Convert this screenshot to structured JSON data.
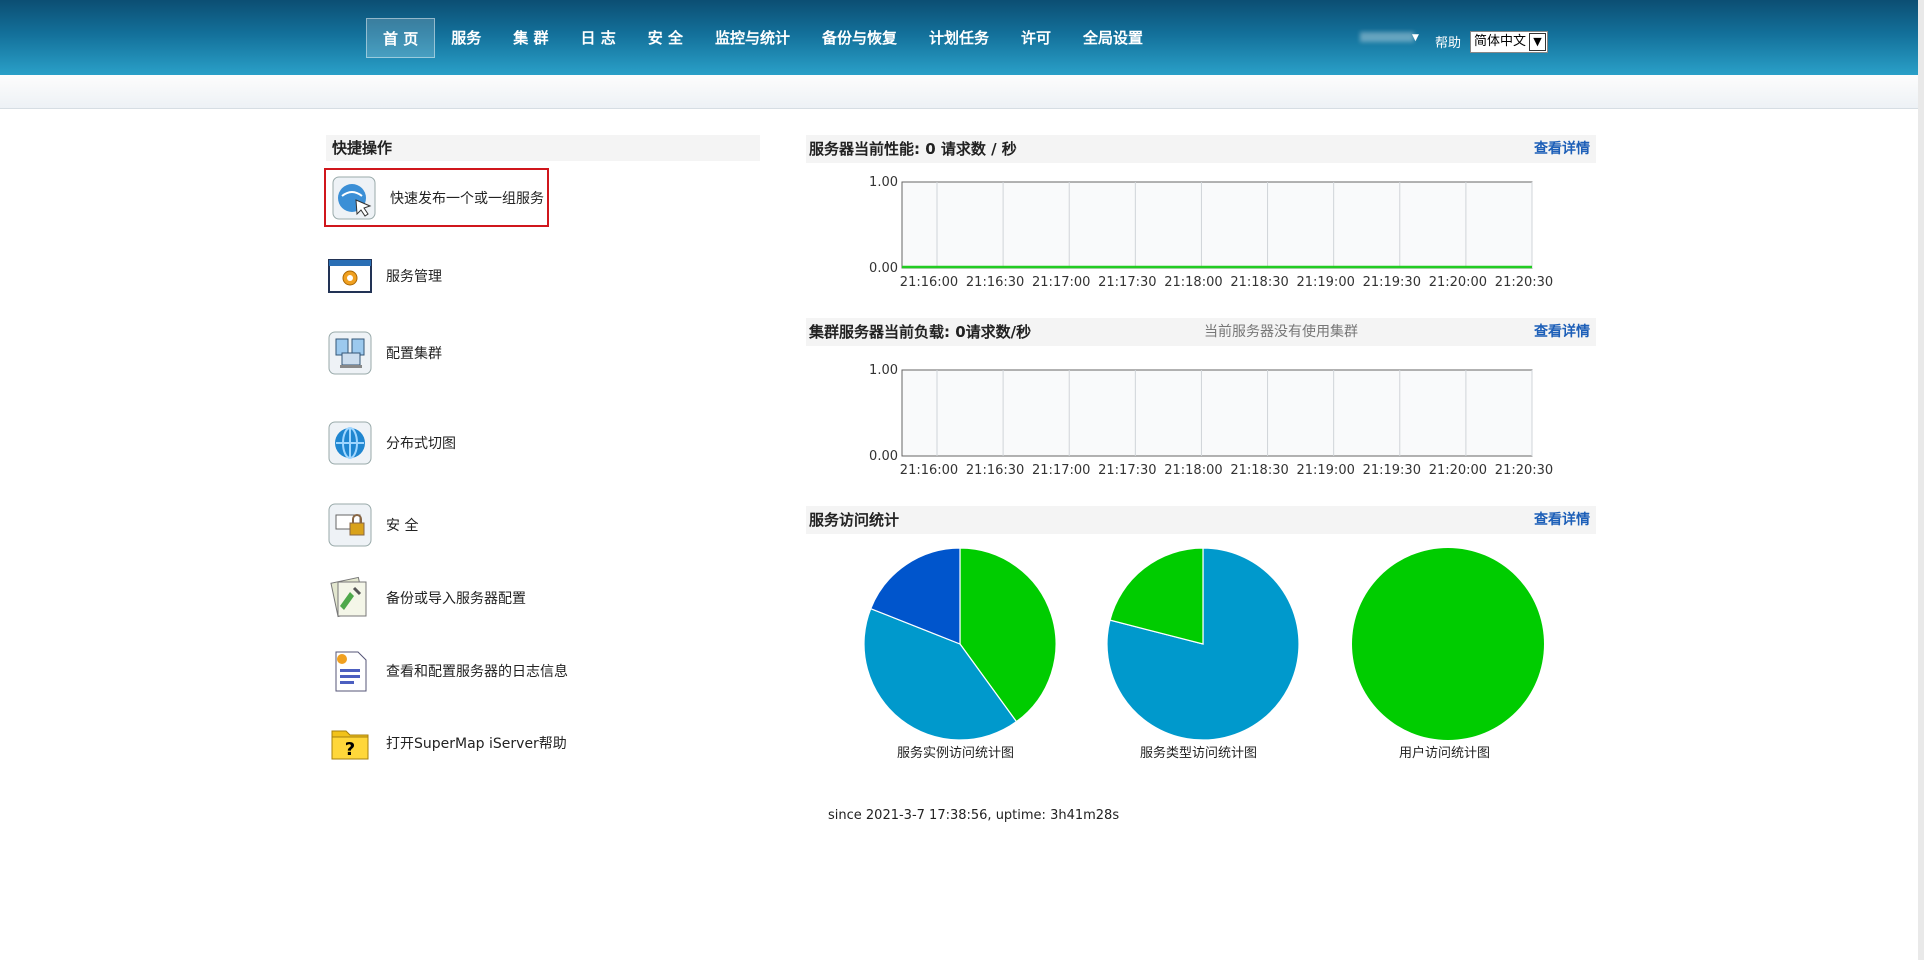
{
  "nav": {
    "items": [
      "首 页",
      "服务",
      "集 群",
      "日 志",
      "安 全",
      "监控与统计",
      "备份与恢复",
      "计划任务",
      "许可",
      "全局设置"
    ],
    "active_index": 0
  },
  "header": {
    "help": "帮助",
    "language": "简体中文"
  },
  "quick_start": {
    "title": "快捷操作",
    "items": [
      {
        "label": "快速发布一个或一组服务",
        "icon": "publish-service-icon"
      },
      {
        "label": "服务管理",
        "icon": "service-manage-icon"
      },
      {
        "label": "配置集群",
        "icon": "cluster-config-icon"
      },
      {
        "label": "分布式切图",
        "icon": "distributed-tile-icon"
      },
      {
        "label": "安 全",
        "icon": "security-lock-icon"
      },
      {
        "label": "备份或导入服务器配置",
        "icon": "backup-config-icon"
      },
      {
        "label": "查看和配置服务器的日志信息",
        "icon": "log-info-icon"
      },
      {
        "label": "打开SuperMap iServer帮助",
        "icon": "help-question-icon"
      }
    ]
  },
  "panels": {
    "performance": {
      "title": "服务器当前性能:  0 请求数 / 秒",
      "more": "查看详情"
    },
    "cluster": {
      "title": "集群服务器当前负载: 0请求数/秒",
      "note": "当前服务器没有使用集群",
      "more": "查看详情"
    },
    "stats": {
      "title": "服务访问统计",
      "more": "查看详情"
    }
  },
  "chart_data": [
    {
      "type": "line",
      "x": [
        "21:16:00",
        "21:16:30",
        "21:17:00",
        "21:17:30",
        "21:18:00",
        "21:18:30",
        "21:19:00",
        "21:19:30",
        "21:20:00",
        "21:20:30"
      ],
      "series": [
        {
          "values": [
            0,
            0,
            0,
            0,
            0,
            0,
            0,
            0,
            0,
            0
          ],
          "color": "#22cc22"
        }
      ],
      "yticks": [
        "1.00",
        "0.00"
      ],
      "ylim": [
        0,
        1
      ]
    },
    {
      "type": "line",
      "x": [
        "21:16:00",
        "21:16:30",
        "21:17:00",
        "21:17:30",
        "21:18:00",
        "21:18:30",
        "21:19:00",
        "21:19:30",
        "21:20:00",
        "21:20:30"
      ],
      "series": [],
      "yticks": [
        "1.00",
        "0.00"
      ],
      "ylim": [
        0,
        1
      ]
    },
    {
      "type": "pie",
      "title": "服务实例访问统计图",
      "values": [
        40,
        41,
        19
      ],
      "colors": [
        "#00cc00",
        "#0099cc",
        "#0055cc"
      ]
    },
    {
      "type": "pie",
      "title": "服务类型访问统计图",
      "values": [
        79,
        21
      ],
      "colors": [
        "#0099cc",
        "#00cc00"
      ]
    },
    {
      "type": "pie",
      "title": "用户访问统计图",
      "values": [
        100
      ],
      "colors": [
        "#00cc00"
      ]
    }
  ],
  "footer": {
    "since": "since 2021-3-7 17:38:56, uptime: 3h41m28s"
  }
}
